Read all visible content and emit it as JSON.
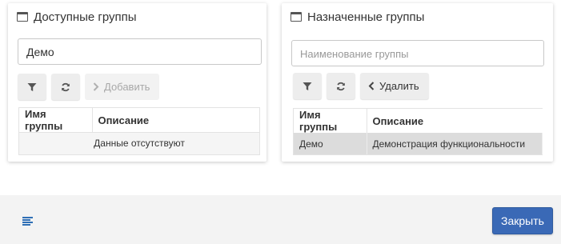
{
  "available": {
    "title": "Доступные группы",
    "search_value": "Демо",
    "add_label": "Добавить",
    "columns": [
      "Имя группы",
      "Описание"
    ],
    "empty_text": "Данные отсутствуют"
  },
  "assigned": {
    "title": "Назначенные группы",
    "search_placeholder": "Наименование группы",
    "remove_label": "Удалить",
    "columns": [
      "Имя группы",
      "Описание"
    ],
    "rows": [
      [
        "Демо",
        "Демонстрация функциональности"
      ]
    ]
  },
  "footer": {
    "close_label": "Закрыть"
  },
  "colors": {
    "primary": "#3a69b6",
    "accent_icon": "#2f6fb6",
    "selected_row": "#dcdcdc"
  },
  "icons": [
    "window-icon",
    "filter-icon",
    "refresh-icon",
    "chevron-right-icon",
    "chevron-left-icon",
    "menu-icon"
  ]
}
